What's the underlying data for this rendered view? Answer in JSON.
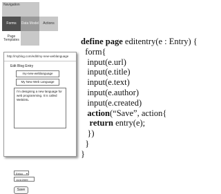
{
  "nav_grid": {
    "cells": [
      "Navigation",
      "",
      "",
      "Forms",
      "Data Model",
      "Actions",
      "Page Templates",
      "",
      ""
    ]
  },
  "blog_form": {
    "url": "http://myblog.com/edit/my-new-weblanguage",
    "heading": "Edit Blog Entry",
    "url_field": "my-new-weblanguage",
    "title_field": "My New Web Language",
    "text_field": "I'm designing a new language for web programming. It is called WebDSL",
    "author_select": "Eelco",
    "created_field": "11/4/2009",
    "save_button": "Save"
  },
  "code": {
    "line1_kw": "define page",
    "line1_rest": " editentry(e : Entry) {",
    "line2": "  form{",
    "line3": "   input(e.url)",
    "line4": "   input(e.title)",
    "line5": "   input(e.text)",
    "line6": "   input(e.author)",
    "line7": "   input(e.created)",
    "line8_kw": "action",
    "line8_rest": "(“Save”, action{",
    "line9_kw": "return",
    "line9_rest": " entry(e);",
    "line10": "   })",
    "line11": "  }",
    "line12": "}"
  }
}
